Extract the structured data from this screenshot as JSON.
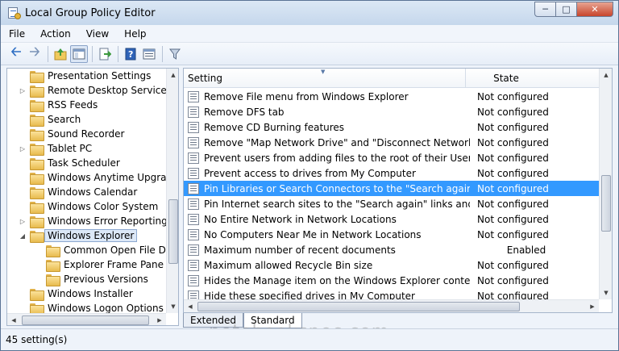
{
  "window": {
    "title": "Local Group Policy Editor"
  },
  "menu": [
    "File",
    "Action",
    "View",
    "Help"
  ],
  "tree": [
    {
      "label": "Presentation Settings",
      "expandable": false,
      "indent": 0
    },
    {
      "label": "Remote Desktop Services",
      "expandable": true,
      "indent": 0
    },
    {
      "label": "RSS Feeds",
      "expandable": false,
      "indent": 0
    },
    {
      "label": "Search",
      "expandable": false,
      "indent": 0
    },
    {
      "label": "Sound Recorder",
      "expandable": false,
      "indent": 0
    },
    {
      "label": "Tablet PC",
      "expandable": true,
      "indent": 0
    },
    {
      "label": "Task Scheduler",
      "expandable": false,
      "indent": 0
    },
    {
      "label": "Windows Anytime Upgrade",
      "expandable": false,
      "indent": 0
    },
    {
      "label": "Windows Calendar",
      "expandable": false,
      "indent": 0
    },
    {
      "label": "Windows Color System",
      "expandable": false,
      "indent": 0
    },
    {
      "label": "Windows Error Reporting",
      "expandable": true,
      "indent": 0
    },
    {
      "label": "Windows Explorer",
      "expandable": true,
      "expanded": true,
      "selected": true,
      "indent": 0
    },
    {
      "label": "Common Open File Dia",
      "expandable": false,
      "indent": 1
    },
    {
      "label": "Explorer Frame Pane",
      "expandable": false,
      "indent": 1
    },
    {
      "label": "Previous Versions",
      "expandable": false,
      "indent": 1
    },
    {
      "label": "Windows Installer",
      "expandable": false,
      "indent": 0
    },
    {
      "label": "Windows Logon Options",
      "expandable": false,
      "indent": 0
    }
  ],
  "columns": {
    "setting": "Setting",
    "state": "State"
  },
  "settings": [
    {
      "name": "Remove File menu from Windows Explorer",
      "state": "Not configured"
    },
    {
      "name": "Remove DFS tab",
      "state": "Not configured"
    },
    {
      "name": "Remove CD Burning features",
      "state": "Not configured"
    },
    {
      "name": "Remove \"Map Network Drive\" and \"Disconnect Network Dri...",
      "state": "Not configured"
    },
    {
      "name": "Prevent users from adding files to the root of their Users File...",
      "state": "Not configured"
    },
    {
      "name": "Prevent access to drives from My Computer",
      "state": "Not configured"
    },
    {
      "name": "Pin Libraries or Search Connectors to the \"Search again\" link...",
      "state": "Not configured",
      "selected": true
    },
    {
      "name": "Pin Internet search sites to the \"Search again\" links and the S...",
      "state": "Not configured"
    },
    {
      "name": "No Entire Network in Network Locations",
      "state": "Not configured"
    },
    {
      "name": "No Computers Near Me in Network Locations",
      "state": "Not configured"
    },
    {
      "name": "Maximum number of recent documents",
      "state": "Enabled"
    },
    {
      "name": "Maximum allowed Recycle Bin size",
      "state": "Not configured"
    },
    {
      "name": "Hides the Manage item on the Windows Explorer context m...",
      "state": "Not configured"
    },
    {
      "name": "Hide these specified drives in My Computer",
      "state": "Not configured"
    }
  ],
  "tabs": [
    "Extended",
    "Standard"
  ],
  "active_tab": "Standard",
  "status": {
    "text": "45 setting(s)"
  },
  "watermark": "notebookspec.com",
  "colors": {
    "selection": "#3399ff",
    "folder": "#e8bb4e"
  },
  "icons": {
    "toolbar": [
      "back-arrow-icon",
      "forward-arrow-icon",
      "up-folder-icon",
      "show-hide-tree-icon",
      "export-list-icon",
      "help-icon",
      "properties-icon",
      "filter-icon"
    ]
  }
}
